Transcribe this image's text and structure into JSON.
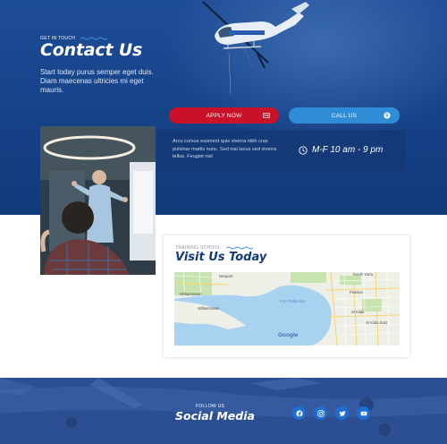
{
  "hero": {
    "eyebrow": "GET IN TOUCH",
    "title": "Contact Us",
    "text": "Start today purus semper eget duis. Diam maecenas ultricies mi eget mauris.",
    "apply_label": "APPLY NOW",
    "call_label": "CALL US",
    "info_text": "Arcu cursus euismod quis viverra nibh cras pulvinar mattis nunc. Sed nisi lacus sed viverra tellus. Feugiat nisl",
    "hours": "M-F 10 am - 9 pm"
  },
  "visit": {
    "eyebrow": "TRAINING SCHOOL",
    "title": "Visit Us Today",
    "map_labels": [
      "Newport",
      "Williamstown",
      "Williamstown",
      "South Yarra",
      "Prahran",
      "St Kilda",
      "St Kilda East",
      "Port Phillip Bay",
      "Google"
    ]
  },
  "footer": {
    "eyebrow": "FOLLOW US",
    "title": "Social Media",
    "social": [
      "facebook-icon",
      "instagram-icon",
      "twitter-icon",
      "youtube-icon"
    ]
  },
  "colors": {
    "hero_blue": "#17448b",
    "apply_red": "#c91229",
    "call_blue": "#2e8dd6",
    "social_blue": "#1d6fd4",
    "title_navy": "#12397a"
  }
}
